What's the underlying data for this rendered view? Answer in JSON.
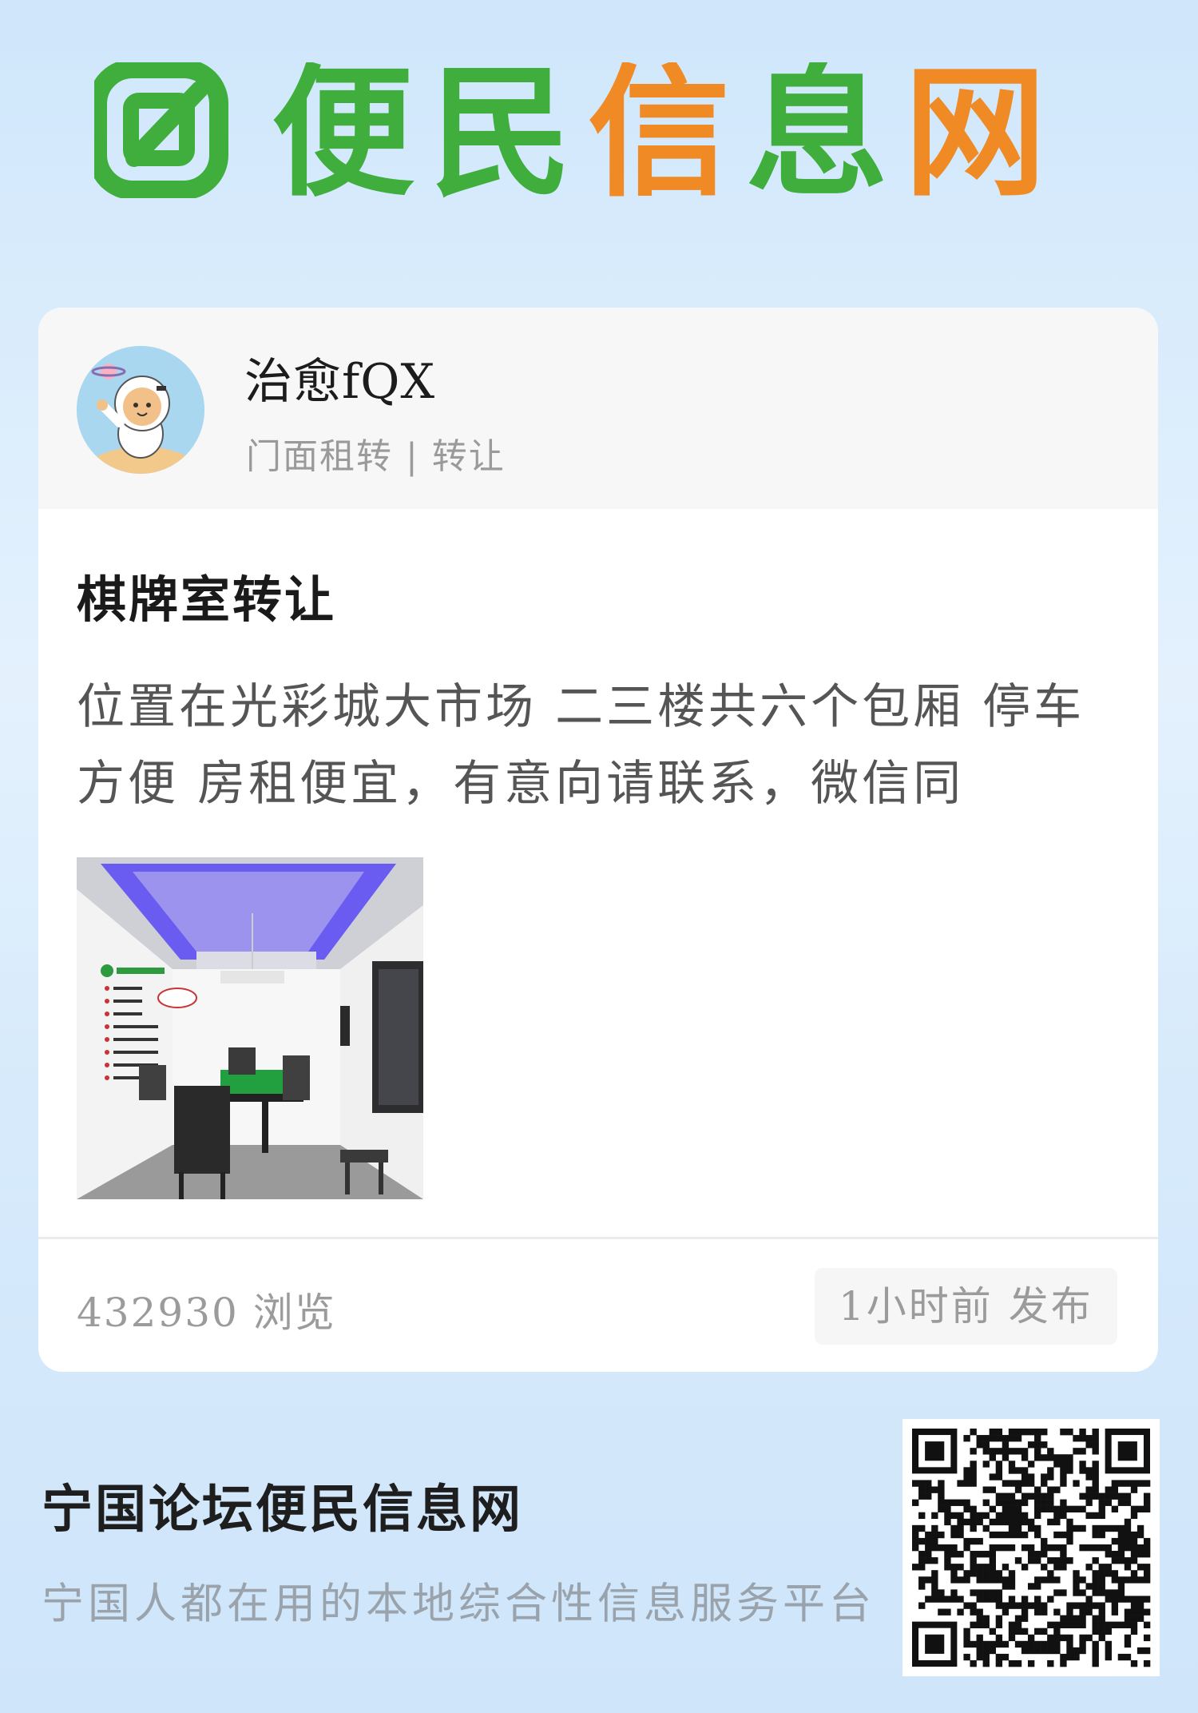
{
  "logo": {
    "text": "便民信息网",
    "icon": "logo-badge-icon",
    "colors": {
      "green": "#3fae3c",
      "orange": "#f08a24"
    }
  },
  "post": {
    "author": "治愈fQX",
    "avatar_icon": "astronaut-avatar",
    "category": "门面租转 | 转让",
    "title": "棋牌室转让",
    "content": "位置在光彩城大市场 二三楼共六个包厢 停车方便 房租便宜，有意向请联系，微信同",
    "photo_icon": "mahjong-room-photo",
    "views": "432930 浏览",
    "published": "1小时前 发布"
  },
  "footer": {
    "title": "宁国论坛便民信息网",
    "subtitle": "宁国人都在用的本地综合性信息服务平台",
    "qr_icon": "qr-code-icon"
  }
}
